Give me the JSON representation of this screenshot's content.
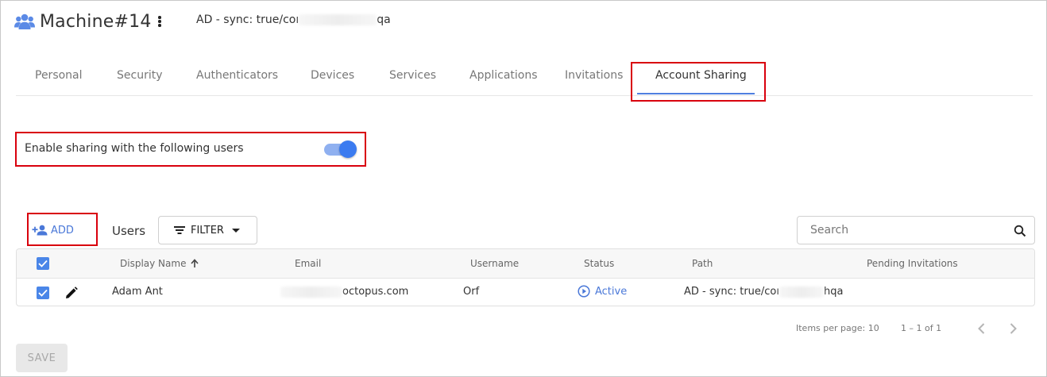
{
  "header": {
    "icon": "users-icon",
    "title": "Machine#14",
    "path_prefix": "AD - sync: true/coı",
    "path_suffix": "qa",
    "menu_icon": "kebab-menu-icon"
  },
  "tabs": [
    {
      "label": "Personal"
    },
    {
      "label": "Security"
    },
    {
      "label": "Authenticators"
    },
    {
      "label": "Devices"
    },
    {
      "label": "Services"
    },
    {
      "label": "Applications"
    },
    {
      "label": "Invitations"
    },
    {
      "label": "Account Sharing",
      "active": true
    }
  ],
  "sharing": {
    "label": "Enable sharing with the following users",
    "enabled": true
  },
  "toolbar": {
    "add_label": "ADD",
    "users_label": "Users",
    "filter_label": "FILTER",
    "search_placeholder": "Search"
  },
  "table": {
    "columns": [
      "Display Name",
      "Email",
      "Username",
      "Status",
      "Path",
      "Pending Invitations"
    ],
    "sort_column": "Display Name",
    "sort_direction": "ascending",
    "rows": [
      {
        "checked": true,
        "display_name": "Adam Ant",
        "email_suffix": "octopus.com",
        "username": "Orf",
        "status": "Active",
        "path_prefix": "AD - sync: true/coı",
        "path_suffix": "hqa",
        "pending_invitations": ""
      }
    ]
  },
  "pagination": {
    "items_per_page_label": "Items per page: 10",
    "range": "1 – 1 of 1"
  },
  "footer": {
    "save_label": "SAVE"
  },
  "colors": {
    "accent": "#4a78d8",
    "checkbox": "#4a86e8",
    "toggle_thumb": "#3b7bf0",
    "toggle_track": "#8fb0f0",
    "highlight": "#d9000d"
  }
}
